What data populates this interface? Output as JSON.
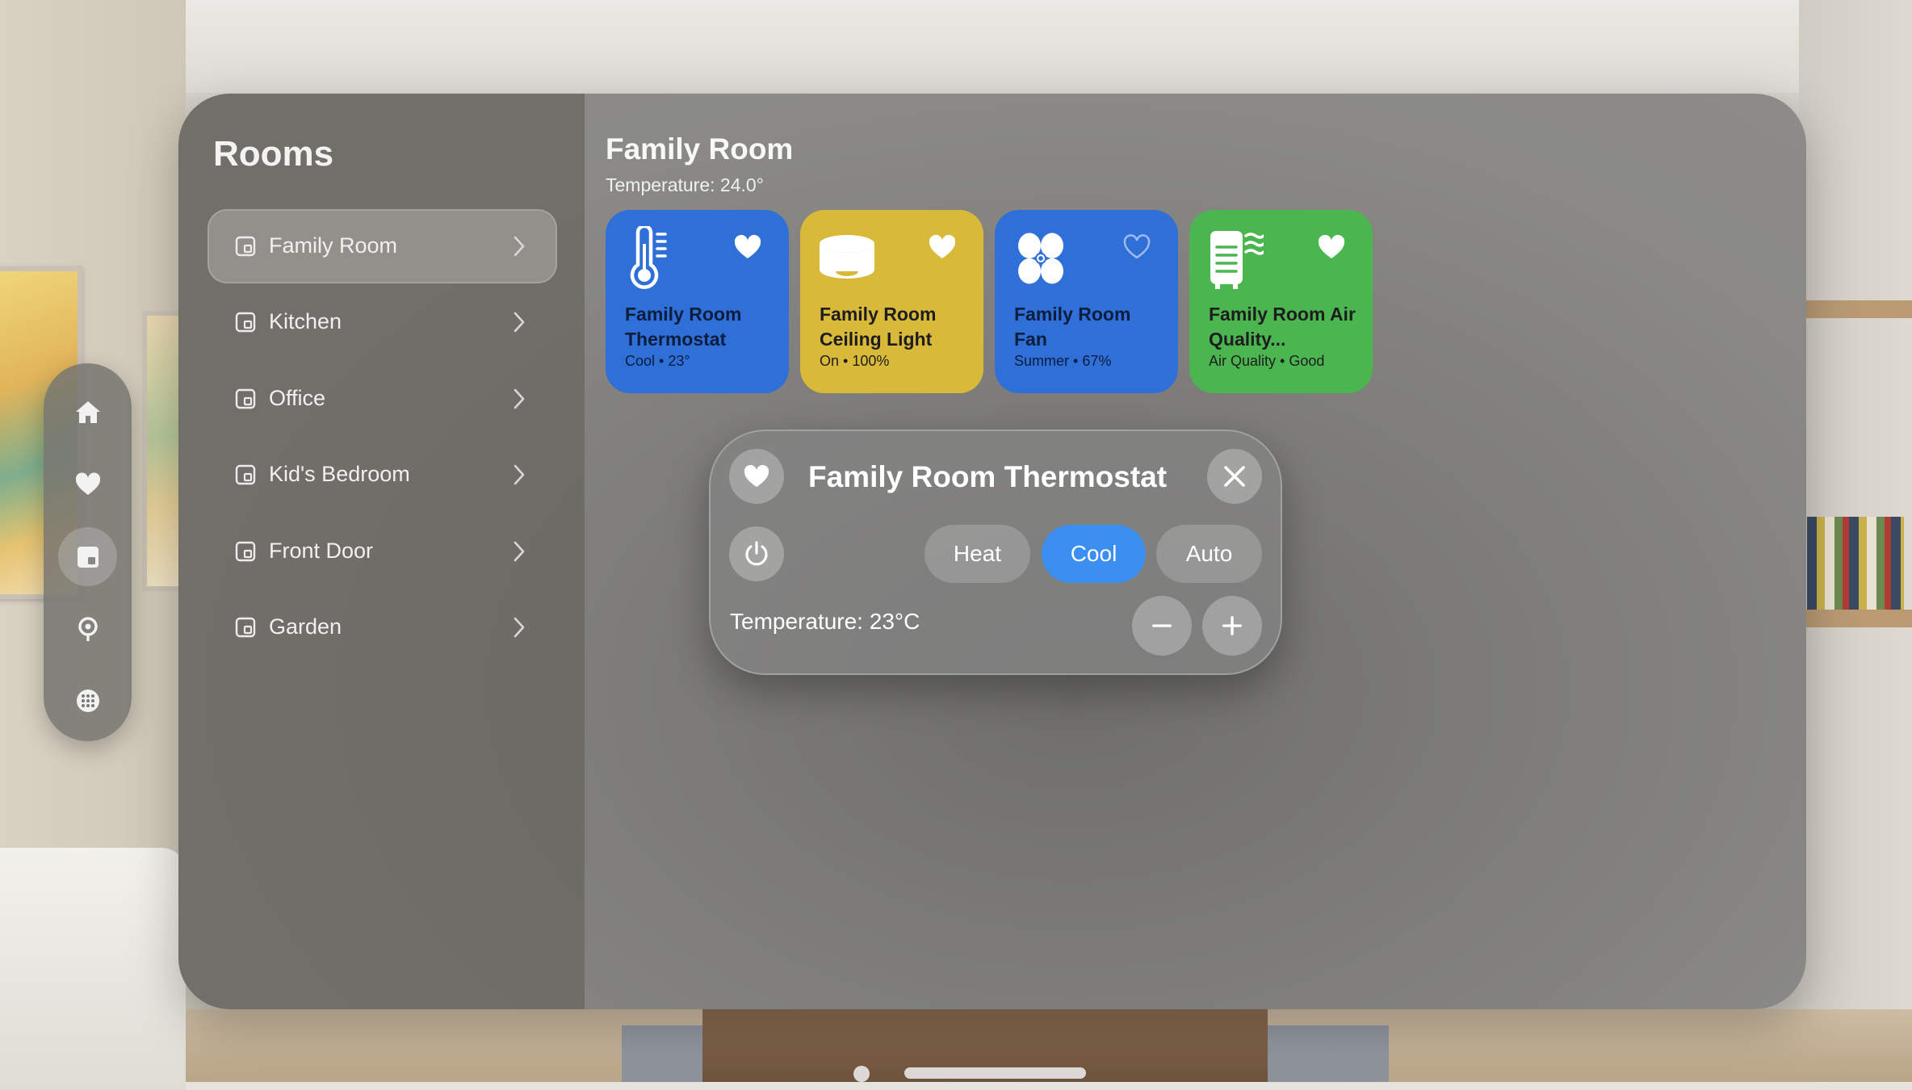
{
  "sidebar": {
    "title": "Rooms",
    "rooms": [
      {
        "label": "Family Room",
        "selected": true
      },
      {
        "label": "Kitchen"
      },
      {
        "label": "Office"
      },
      {
        "label": "Kid's Bedroom"
      },
      {
        "label": "Front Door"
      },
      {
        "label": "Garden"
      }
    ]
  },
  "ornament": {
    "items": [
      {
        "icon": "home-icon"
      },
      {
        "icon": "heart-icon"
      },
      {
        "icon": "rooms-icon",
        "selected": true
      },
      {
        "icon": "location-icon"
      },
      {
        "icon": "grid-icon"
      }
    ]
  },
  "main": {
    "title": "Family Room",
    "subtitle": "Temperature: 24.0°",
    "tiles": [
      {
        "name": "Family Room Thermostat",
        "state": "Cool • 23°",
        "color": "#2f6fd8",
        "favorite": true,
        "icon": "thermometer-icon"
      },
      {
        "name": "Family Room Ceiling Light",
        "state": "On • 100%",
        "color": "#d9b93a",
        "favorite": true,
        "icon": "ceiling-light-icon"
      },
      {
        "name": "Family Room Fan",
        "state": "Summer • 67%",
        "color": "#2f6fd8",
        "favorite": false,
        "icon": "fan-icon"
      },
      {
        "name": "Family Room Air Quality...",
        "state": "Air Quality • Good",
        "color": "#4bb54f",
        "favorite": true,
        "icon": "air-quality-icon"
      }
    ]
  },
  "popover": {
    "title": "Family Room Thermostat",
    "modes": [
      "Heat",
      "Cool",
      "Auto"
    ],
    "selected_mode": "Cool",
    "temperature_label": "Temperature: 23°C"
  },
  "colors": {
    "accent_blue": "#3b8ff0",
    "tile_blue": "#2f6fd8",
    "tile_yellow": "#d9b93a",
    "tile_green": "#4bb54f"
  }
}
